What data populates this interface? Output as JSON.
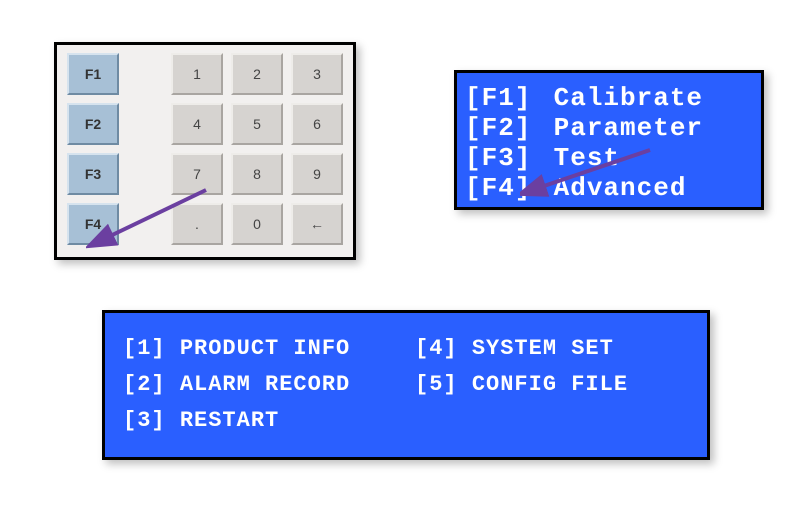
{
  "keypad": {
    "fkeys": [
      "F1",
      "F2",
      "F3",
      "F4"
    ],
    "rows": [
      [
        "1",
        "2",
        "3"
      ],
      [
        "4",
        "5",
        "6"
      ],
      [
        "7",
        "8",
        "9"
      ],
      [
        ".",
        "0",
        "←"
      ]
    ]
  },
  "lcd_menu": {
    "items": [
      {
        "tag": "[F1]",
        "label": "Calibrate"
      },
      {
        "tag": "[F2]",
        "label": "Parameter"
      },
      {
        "tag": "[F3]",
        "label": "Test"
      },
      {
        "tag": "[F4]",
        "label": "Advanced"
      }
    ]
  },
  "advanced_menu": {
    "items": [
      {
        "tag": "[1]",
        "label": "PRODUCT INFO"
      },
      {
        "tag": "[2]",
        "label": "ALARM RECORD"
      },
      {
        "tag": "[3]",
        "label": "RESTART"
      },
      {
        "tag": "[4]",
        "label": "SYSTEM SET"
      },
      {
        "tag": "[5]",
        "label": "CONFIG FILE"
      }
    ]
  },
  "colors": {
    "lcd_bg": "#2a5fff",
    "lcd_fg": "#ffffff",
    "fkey_bg": "#a7c0d6",
    "numkey_bg": "#d6d3d0",
    "arrow": "#6b3fa0"
  }
}
